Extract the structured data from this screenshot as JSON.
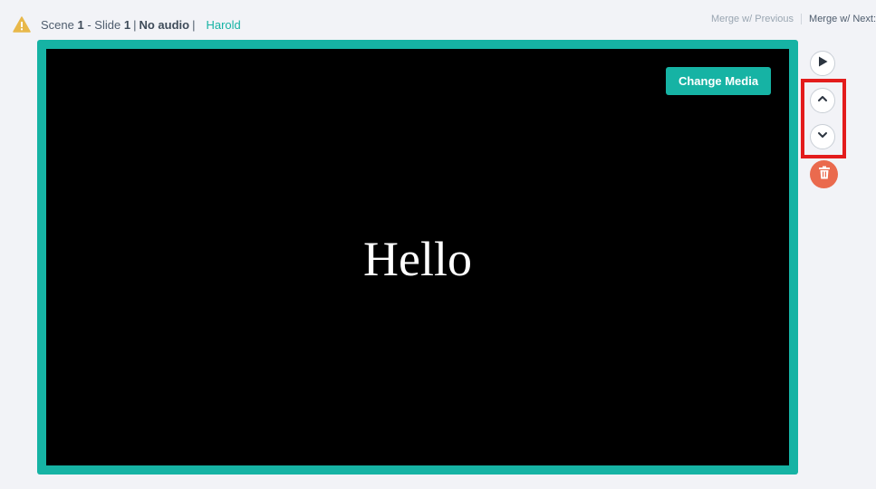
{
  "header": {
    "scene_label": "Scene",
    "scene_number": "1",
    "dash": " - ",
    "slide_label": "Slide",
    "slide_number": "1",
    "separator": "|",
    "audio_status": "No audio",
    "voice_name": "Harold",
    "warning_icon": "warning-triangle-icon"
  },
  "merge": {
    "previous_label": "Merge w/ Previous",
    "next_label": "Merge w/ Next:"
  },
  "slide": {
    "change_media_label": "Change Media",
    "text": "Hello"
  },
  "controls": {
    "play_icon": "play-icon",
    "move_up_icon": "chevron-up-icon",
    "move_down_icon": "chevron-down-icon",
    "delete_icon": "trash-icon"
  },
  "colors": {
    "accent": "#16b3a4",
    "delete": "#ea6a4e",
    "highlight": "#e31c1c",
    "warning": "#e8b84a"
  }
}
